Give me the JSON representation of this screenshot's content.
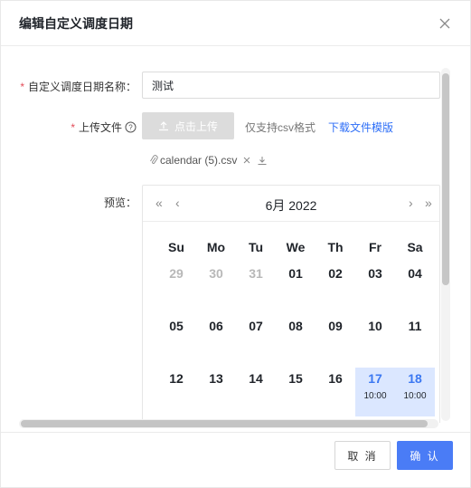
{
  "dialog": {
    "title": "编辑自定义调度日期"
  },
  "form": {
    "name_label": "自定义调度日期名称：",
    "name_value": "测试",
    "file_label": "上传文件",
    "upload_button": "点击上传",
    "upload_hint": "仅支持csv格式",
    "download_template": "下载文件模版",
    "file_name": "calendar (5).csv",
    "preview_label": "预览："
  },
  "calendar": {
    "month_title": "6月 2022",
    "weekdays": [
      "Su",
      "Mo",
      "Tu",
      "We",
      "Th",
      "Fr",
      "Sa"
    ],
    "weeks": [
      [
        {
          "d": "29",
          "muted": true
        },
        {
          "d": "30",
          "muted": true
        },
        {
          "d": "31",
          "muted": true
        },
        {
          "d": "01"
        },
        {
          "d": "02"
        },
        {
          "d": "03"
        },
        {
          "d": "04"
        }
      ],
      [
        {
          "d": "05"
        },
        {
          "d": "06"
        },
        {
          "d": "07"
        },
        {
          "d": "08"
        },
        {
          "d": "09"
        },
        {
          "d": "10"
        },
        {
          "d": "11"
        }
      ],
      [
        {
          "d": "12"
        },
        {
          "d": "13"
        },
        {
          "d": "14"
        },
        {
          "d": "15"
        },
        {
          "d": "16"
        },
        {
          "d": "17",
          "selected": true,
          "time": "10:00"
        },
        {
          "d": "18",
          "selected": true,
          "time": "10:00"
        }
      ]
    ]
  },
  "footer": {
    "cancel_label": "取 消",
    "confirm_label": "确 认"
  },
  "colors": {
    "primary": "#4a7cf6",
    "link": "#2d6ef7",
    "required": "#e34d59",
    "selected_bg": "#dbe7ff"
  }
}
